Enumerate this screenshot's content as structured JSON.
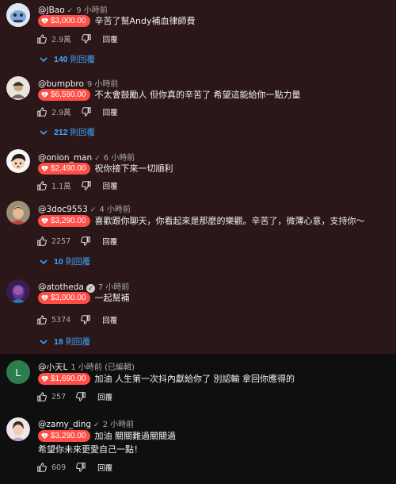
{
  "ui": {
    "reply_label": "回覆"
  },
  "comments": [
    {
      "handle": "@JBao",
      "check": "✓",
      "time": "9 小時前",
      "amount": "$3,000.00",
      "text": "辛苦了幫Andy補血律師費",
      "likes": "2.9萬",
      "replies": {
        "num": "140",
        "label": "則回覆"
      },
      "avatar": {
        "letter": "",
        "color": "#cfd8e3"
      }
    },
    {
      "handle": "@bumpbro",
      "check": "",
      "time": "9 小時前",
      "amount": "$6,590.00",
      "text": "不太會鼓勵人 但你真的辛苦了 希望這能給你一點力量",
      "likes": "2.9萬",
      "replies": {
        "num": "212",
        "label": "則回覆"
      },
      "avatar": {
        "letter": "",
        "color": "#d8d2c8"
      }
    },
    {
      "handle": "@onion_man",
      "check": "✓",
      "time": "6 小時前",
      "amount": "$2,490.00",
      "text": "祝你接下來一切順利",
      "likes": "1.1萬",
      "replies": null,
      "avatar": {
        "letter": "",
        "color": "#f2f2f2"
      }
    },
    {
      "handle": "@3doc9553",
      "check": "✓",
      "time": "4 小時前",
      "amount": "$3,290.00",
      "text": "喜歡跟你聊天，你看起來是那麼的樂觀。辛苦了，微薄心意，支持你～",
      "likes": "2257",
      "replies": {
        "num": "10",
        "label": "則回覆"
      },
      "avatar": {
        "letter": "",
        "color": "#b9a07a"
      }
    },
    {
      "handle": "@atotheda",
      "check": "",
      "verified": "✓",
      "time": "7 小時前",
      "amount": "$3,000.00",
      "text": "一起幫補",
      "likes": "5374",
      "replies": {
        "num": "18",
        "label": "則回覆"
      },
      "avatar": {
        "letter": "",
        "color": "#5a2a6e"
      }
    },
    {
      "handle": "@小天L",
      "check": "",
      "time": "1 小時前 (已編輯)",
      "amount": "$1,690.00",
      "text": "加油 人生第一次抖內獻給你了 別認輸 拿回你應得的",
      "likes": "257",
      "replies": null,
      "avatar": {
        "letter": "L",
        "color": "#2e7d4f"
      }
    },
    {
      "handle": "@zamy_ding",
      "check": "✓",
      "time": "2 小時前",
      "amount": "$3,290.00",
      "text": "加油 關關難過關關過",
      "text2": "希望你未來更愛自己一點！",
      "likes": "609",
      "replies": null,
      "avatar": {
        "letter": "",
        "color": "#e8dfe6"
      }
    }
  ]
}
